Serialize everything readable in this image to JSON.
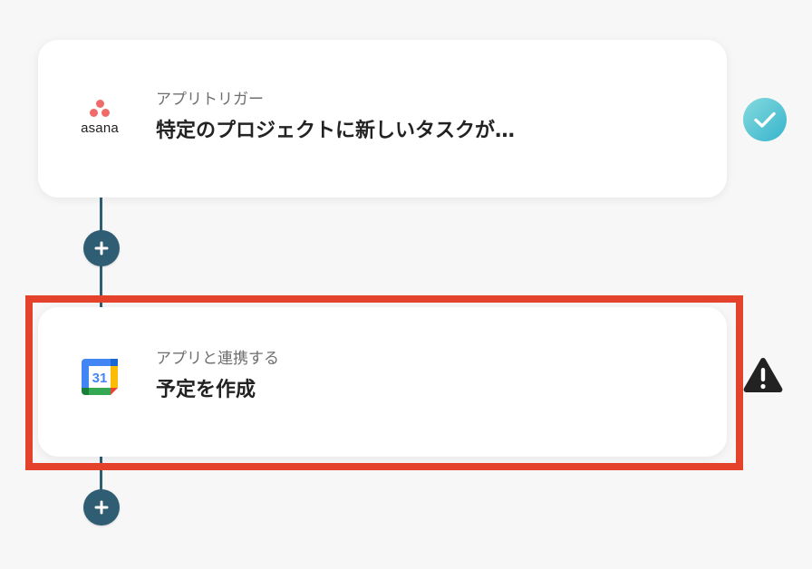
{
  "colors": {
    "background": "#f7f7f7",
    "connector": "#2f5d73",
    "highlight": "#e5422c",
    "asana_brand": "#f06a6a",
    "success_gradient_start": "#7fd3d8",
    "success_gradient_end": "#3bb9cf",
    "warning": "#222222"
  },
  "steps": [
    {
      "app_logo": "asana-logo",
      "app_logo_text": "asana",
      "subtitle": "アプリトリガー",
      "title": "特定のプロジェクトに新しいタスクが…",
      "status": "success-check-icon"
    },
    {
      "app_logo": "google-calendar-logo",
      "app_logo_text": "31",
      "subtitle": "アプリと連携する",
      "title": "予定を作成",
      "status": "warning-icon"
    }
  ],
  "add_buttons": [
    {
      "icon": "plus-icon"
    },
    {
      "icon": "plus-icon"
    }
  ]
}
